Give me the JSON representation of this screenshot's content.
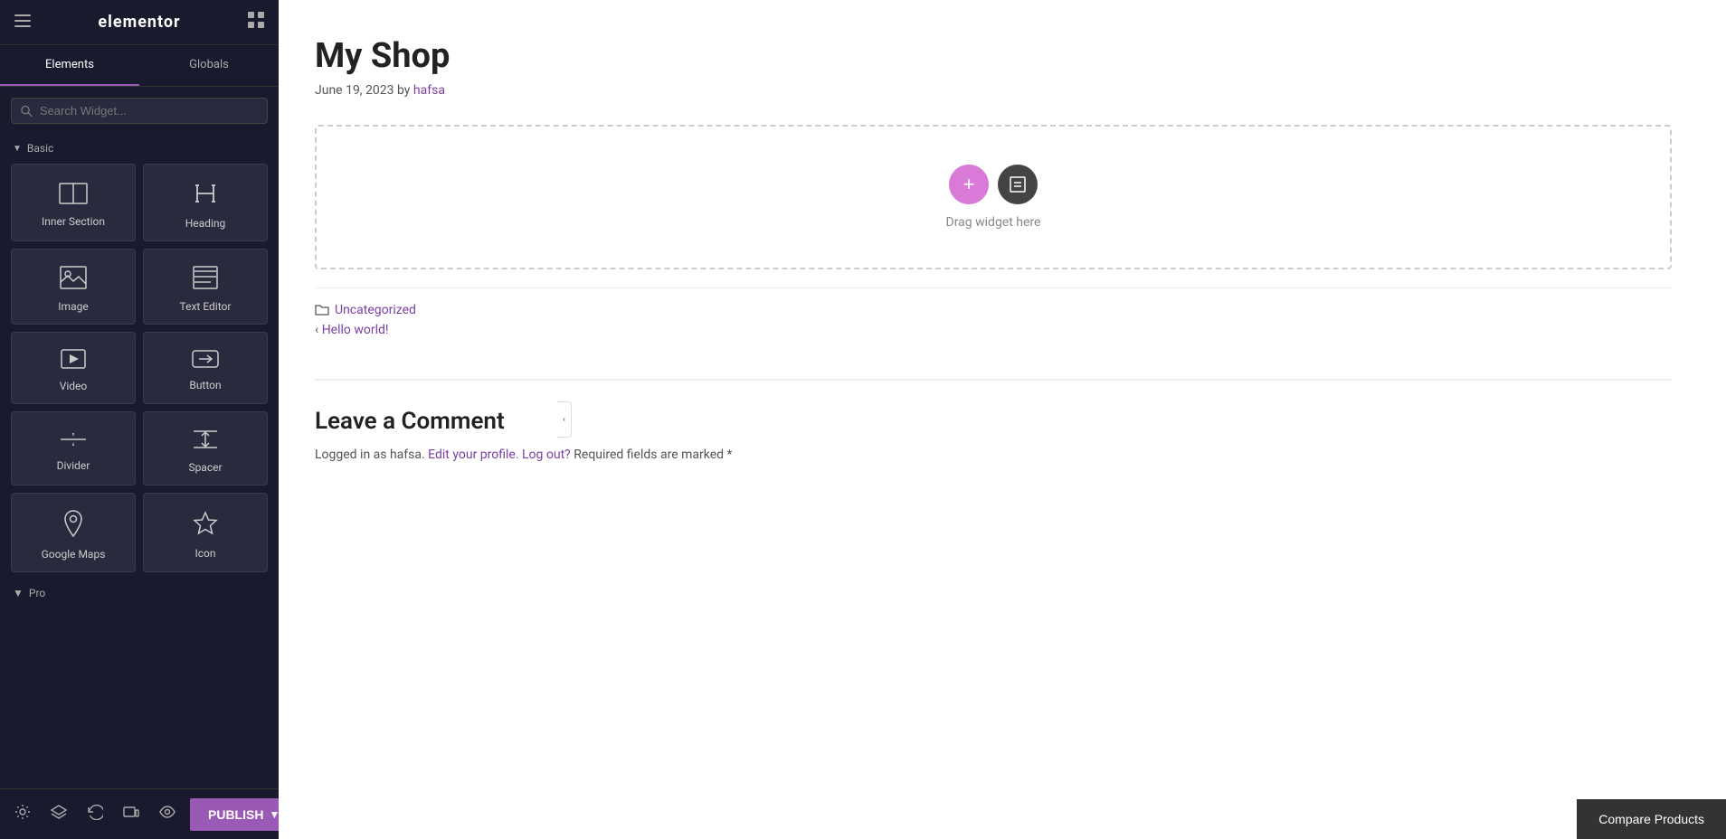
{
  "panel": {
    "logo": "elementor",
    "tabs": [
      {
        "id": "elements",
        "label": "Elements",
        "active": true
      },
      {
        "id": "globals",
        "label": "Globals",
        "active": false
      }
    ],
    "search": {
      "placeholder": "Search Widget..."
    },
    "basic_section_label": "Basic",
    "widgets": [
      {
        "id": "inner-section",
        "label": "Inner Section",
        "icon": "inner-section-icon"
      },
      {
        "id": "heading",
        "label": "Heading",
        "icon": "heading-icon"
      },
      {
        "id": "image",
        "label": "Image",
        "icon": "image-icon"
      },
      {
        "id": "text-editor",
        "label": "Text Editor",
        "icon": "text-editor-icon"
      },
      {
        "id": "video",
        "label": "Video",
        "icon": "video-icon"
      },
      {
        "id": "button",
        "label": "Button",
        "icon": "button-icon"
      },
      {
        "id": "divider",
        "label": "Divider",
        "icon": "divider-icon"
      },
      {
        "id": "spacer",
        "label": "Spacer",
        "icon": "spacer-icon"
      },
      {
        "id": "google-maps",
        "label": "Google Maps",
        "icon": "google-maps-icon"
      },
      {
        "id": "icon",
        "label": "Icon",
        "icon": "icon-widget-icon"
      }
    ],
    "pro_section_label": "Pro",
    "footer_icons": [
      {
        "id": "settings",
        "icon": "gear-icon"
      },
      {
        "id": "layers",
        "icon": "layers-icon"
      },
      {
        "id": "history",
        "icon": "history-icon"
      },
      {
        "id": "responsive",
        "icon": "responsive-icon"
      },
      {
        "id": "eye",
        "icon": "eye-icon"
      }
    ],
    "publish_label": "PUBLISH"
  },
  "page": {
    "title": "My Shop",
    "meta": {
      "date": "June 19, 2023",
      "by": "by",
      "author": "hafsa"
    },
    "drop_zone_label": "Drag widget here",
    "post_footer": {
      "category": "Uncategorized",
      "prev_post": "Hello world!"
    },
    "comments": {
      "title": "Leave a Comment",
      "logged_in_text": "Logged in as hafsa.",
      "edit_profile": "Edit your profile.",
      "log_out": "Log out?",
      "required_fields": "Required fields are marked *"
    }
  },
  "compare_products": {
    "label": "Compare Products"
  }
}
